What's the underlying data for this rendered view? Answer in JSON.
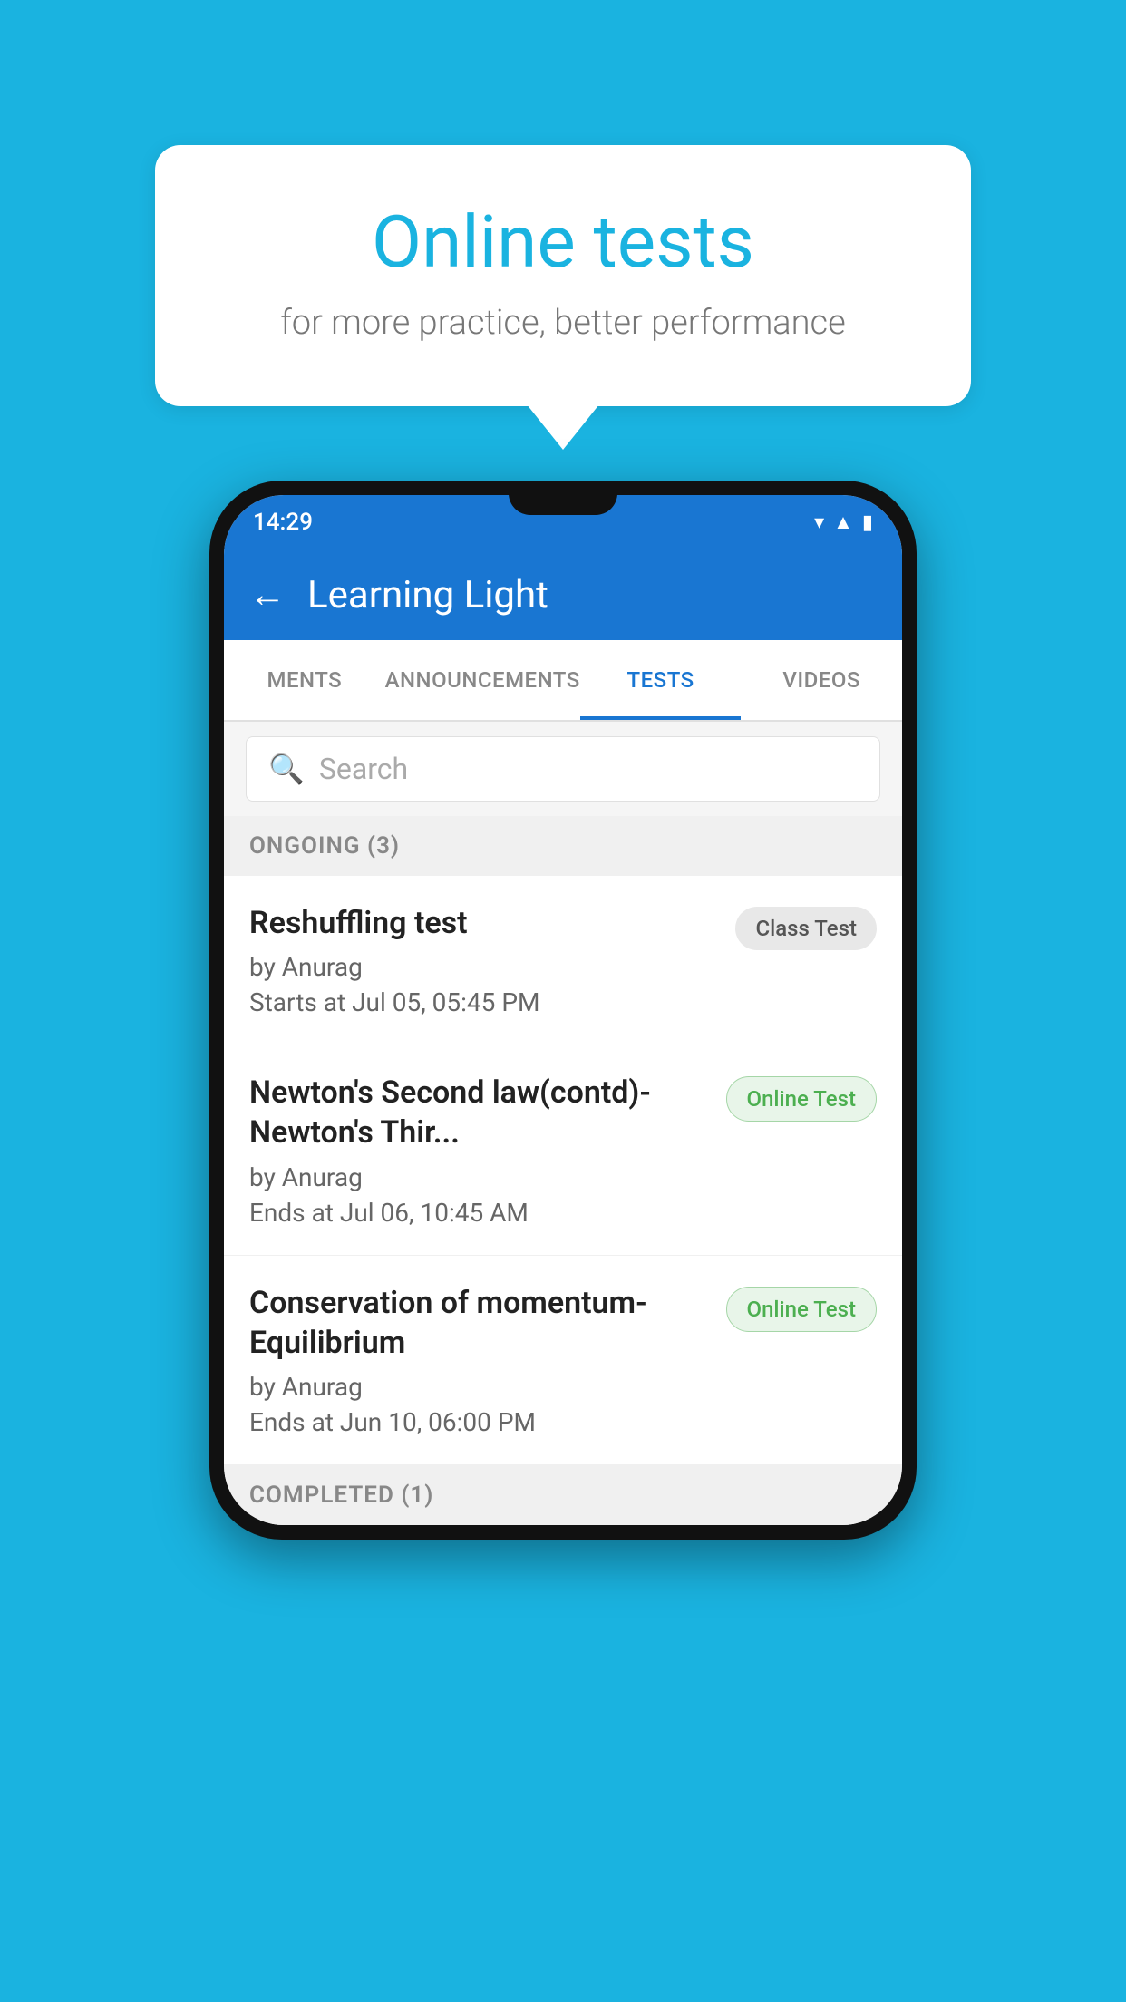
{
  "background_color": "#1ab3e0",
  "speech_bubble": {
    "title": "Online tests",
    "subtitle": "for more practice, better performance"
  },
  "phone": {
    "status_bar": {
      "time": "14:29",
      "icons": [
        "wifi",
        "signal",
        "battery"
      ]
    },
    "app_bar": {
      "title": "Learning Light",
      "back_label": "←"
    },
    "tabs": [
      {
        "label": "MENTS",
        "active": false
      },
      {
        "label": "ANNOUNCEMENTS",
        "active": false
      },
      {
        "label": "TESTS",
        "active": true
      },
      {
        "label": "VIDEOS",
        "active": false
      }
    ],
    "search": {
      "placeholder": "Search"
    },
    "ongoing_section": {
      "label": "ONGOING (3)"
    },
    "tests": [
      {
        "name": "Reshuffling test",
        "author": "by Anurag",
        "time_label": "Starts at",
        "time": "Jul 05, 05:45 PM",
        "badge": "Class Test",
        "badge_type": "class"
      },
      {
        "name": "Newton's Second law(contd)-Newton's Thir...",
        "author": "by Anurag",
        "time_label": "Ends at",
        "time": "Jul 06, 10:45 AM",
        "badge": "Online Test",
        "badge_type": "online"
      },
      {
        "name": "Conservation of momentum-Equilibrium",
        "author": "by Anurag",
        "time_label": "Ends at",
        "time": "Jun 10, 06:00 PM",
        "badge": "Online Test",
        "badge_type": "online"
      }
    ],
    "completed_section": {
      "label": "COMPLETED (1)"
    }
  }
}
